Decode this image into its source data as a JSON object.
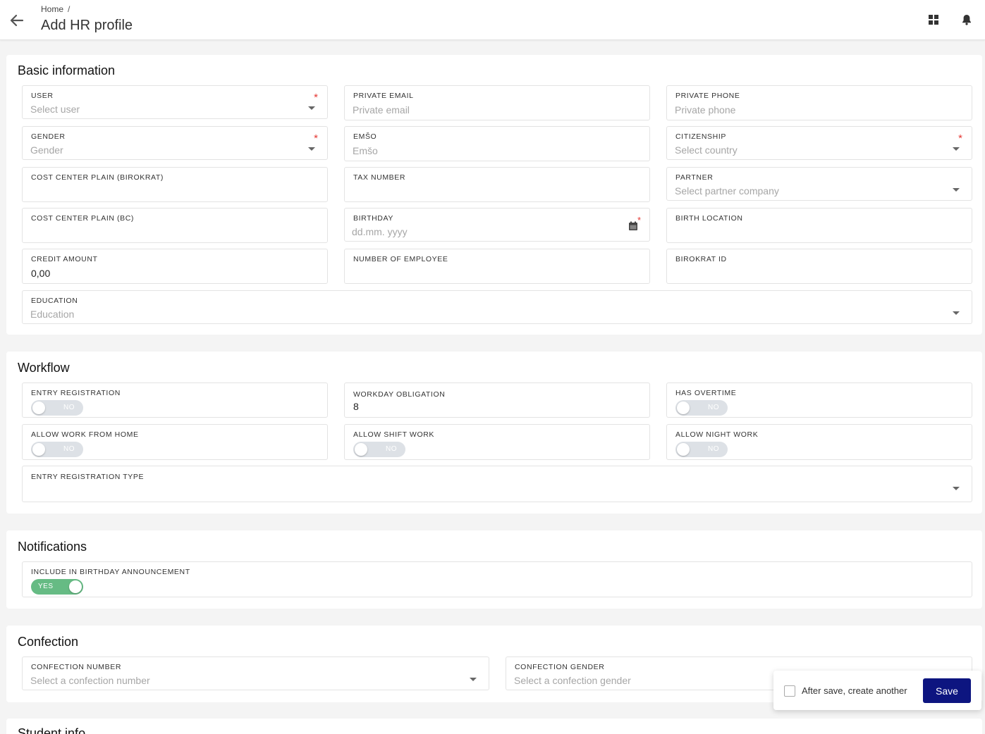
{
  "header": {
    "breadcrumb_home": "Home",
    "breadcrumb_sep": "/",
    "title": "Add HR profile",
    "icons": [
      "back-arrow-icon",
      "grid-icon",
      "bell-icon"
    ]
  },
  "basic": {
    "title": "Basic information",
    "user_label": "USER",
    "user_placeholder": "Select user",
    "private_email_label": "PRIVATE EMAIL",
    "private_email_placeholder": "Private email",
    "private_phone_label": "PRIVATE PHONE",
    "private_phone_placeholder": "Private phone",
    "gender_label": "GENDER",
    "gender_placeholder": "Gender",
    "emso_label": "EMŠO",
    "emso_placeholder": "Emšo",
    "citizenship_label": "CITIZENSHIP",
    "citizenship_placeholder": "Select country",
    "cost_center_birokrat_label": "COST CENTER PLAIN (BIROKRAT)",
    "tax_number_label": "TAX NUMBER",
    "partner_label": "PARTNER",
    "partner_placeholder": "Select partner company",
    "cost_center_bc_label": "COST CENTER PLAIN (BC)",
    "birthday_label": "BIRTHDAY",
    "birthday_placeholder": "dd.mm. yyyy",
    "birth_location_label": "BIRTH LOCATION",
    "credit_amount_label": "CREDIT AMOUNT",
    "credit_amount_value": "0,00",
    "number_of_employee_label": "NUMBER OF EMPLOYEE",
    "birokrat_id_label": "BIROKRAT ID",
    "education_label": "EDUCATION",
    "education_placeholder": "Education",
    "required_mark": "*"
  },
  "workflow": {
    "title": "Workflow",
    "entry_registration_label": "ENTRY REGISTRATION",
    "entry_registration_state": "NO",
    "workday_obligation_label": "WORKDAY OBLIGATION",
    "workday_obligation_value": "8",
    "has_overtime_label": "HAS OVERTIME",
    "has_overtime_state": "NO",
    "allow_wfh_label": "ALLOW WORK FROM HOME",
    "allow_wfh_state": "NO",
    "allow_shift_label": "ALLOW SHIFT WORK",
    "allow_shift_state": "NO",
    "allow_night_label": "ALLOW NIGHT WORK",
    "allow_night_state": "NO",
    "entry_registration_type_label": "ENTRY REGISTRATION TYPE"
  },
  "notifications": {
    "title": "Notifications",
    "birthday_announcement_label": "INCLUDE IN BIRTHDAY ANNOUNCEMENT",
    "birthday_announcement_state": "YES"
  },
  "confection": {
    "title": "Confection",
    "number_label": "CONFECTION NUMBER",
    "number_placeholder": "Select a confection number",
    "gender_label": "CONFECTION GENDER",
    "gender_placeholder": "Select a confection gender"
  },
  "student": {
    "title": "Student info"
  },
  "savebar": {
    "checkbox_label": "After save, create another",
    "save_label": "Save"
  },
  "colors": {
    "primary": "#0d1580",
    "toggle_on": "#66bb84",
    "required": "#e53935"
  }
}
